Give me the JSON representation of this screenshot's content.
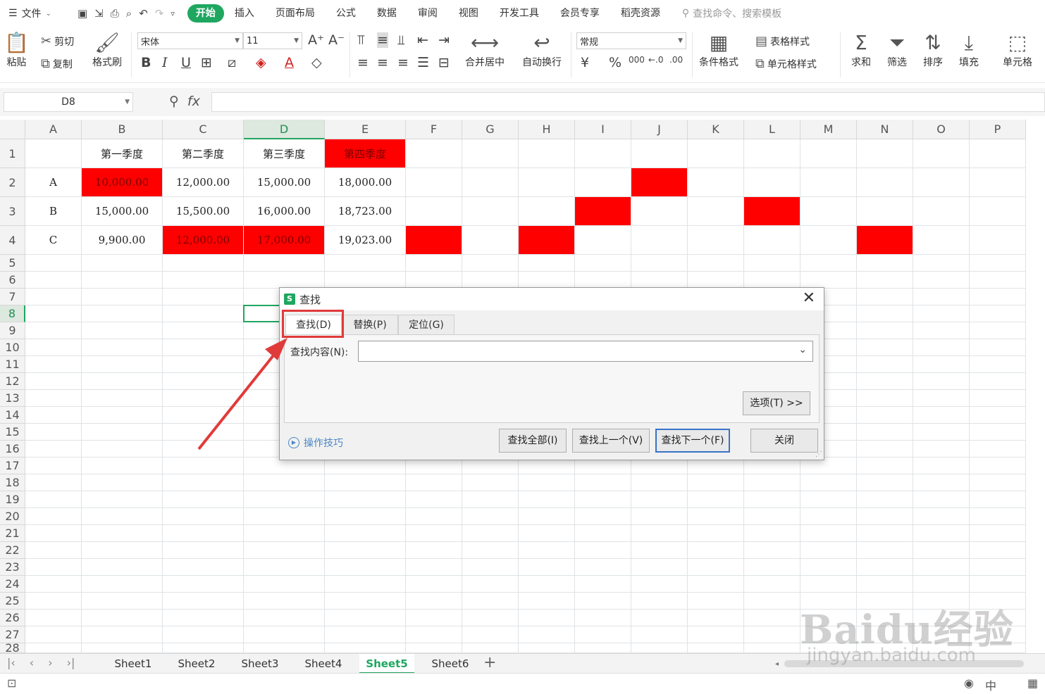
{
  "menubar": {
    "file_label": "文件",
    "tabs": [
      "开始",
      "插入",
      "页面布局",
      "公式",
      "数据",
      "审阅",
      "视图",
      "开发工具",
      "会员专享",
      "稻壳资源"
    ],
    "search_placeholder": "查找命令、搜索模板"
  },
  "ribbon": {
    "paste": "粘贴",
    "cut": "剪切",
    "copy": "复制",
    "format_painter": "格式刷",
    "font_name": "宋体",
    "font_size": "11",
    "merge_center": "合并居中",
    "wrap_text": "自动换行",
    "number_format": "常规",
    "conditional_format": "条件格式",
    "table_style": "表格样式",
    "cell_style": "单元格样式",
    "sum": "求和",
    "filter": "筛选",
    "sort": "排序",
    "fill": "填充",
    "cell": "单元格"
  },
  "formula_bar": {
    "name_box": "D8",
    "fx": "fx",
    "formula": ""
  },
  "grid": {
    "columns": [
      "A",
      "B",
      "C",
      "D",
      "E",
      "F",
      "G",
      "H",
      "I",
      "J",
      "K",
      "L",
      "M",
      "N",
      "O",
      "P"
    ],
    "selected_column": "D",
    "selected_row": "8",
    "rows": [
      "1",
      "2",
      "3",
      "4",
      "5",
      "6",
      "7",
      "8",
      "9",
      "10",
      "11",
      "12",
      "13",
      "14",
      "15",
      "16",
      "17",
      "18",
      "19",
      "20",
      "21",
      "22",
      "23",
      "24",
      "25",
      "26",
      "27",
      "28"
    ],
    "cells": {
      "B1": "第一季度",
      "C1": "第二季度",
      "D1": "第三季度",
      "E1": "第四季度",
      "A2": "A",
      "B2": "10,000.00",
      "C2": "12,000.00",
      "D2": "15,000.00",
      "E2": "18,000.00",
      "A3": "B",
      "B3": "15,000.00",
      "C3": "15,500.00",
      "D3": "16,000.00",
      "E3": "18,723.00",
      "A4": "C",
      "B4": "9,900.00",
      "C4": "12,000.00",
      "D4": "17,000.00",
      "E4": "19,023.00"
    },
    "red_cells": [
      "E1",
      "B2",
      "J2",
      "I3",
      "L3",
      "C4",
      "D4",
      "F4",
      "H4",
      "N4"
    ],
    "highlight_color": "#ff0000"
  },
  "sheets": {
    "tabs": [
      "Sheet1",
      "Sheet2",
      "Sheet3",
      "Sheet4",
      "Sheet5",
      "Sheet6"
    ],
    "active": "Sheet5"
  },
  "dialog": {
    "title": "查找",
    "tabs": [
      "查找(D)",
      "替换(P)",
      "定位(G)"
    ],
    "active_tab": "查找(D)",
    "find_label": "查找内容(N):",
    "find_value": "",
    "options_button": "选项(T) >>",
    "tips": "操作技巧",
    "buttons": {
      "find_all": "查找全部(I)",
      "find_prev": "查找上一个(V)",
      "find_next": "查找下一个(F)",
      "close": "关闭"
    }
  },
  "watermark": {
    "main": "Baidu经验",
    "sub": "jingyan.baidu.com"
  },
  "colors": {
    "accent": "#1fa760",
    "annotation": "#e03b3b"
  }
}
